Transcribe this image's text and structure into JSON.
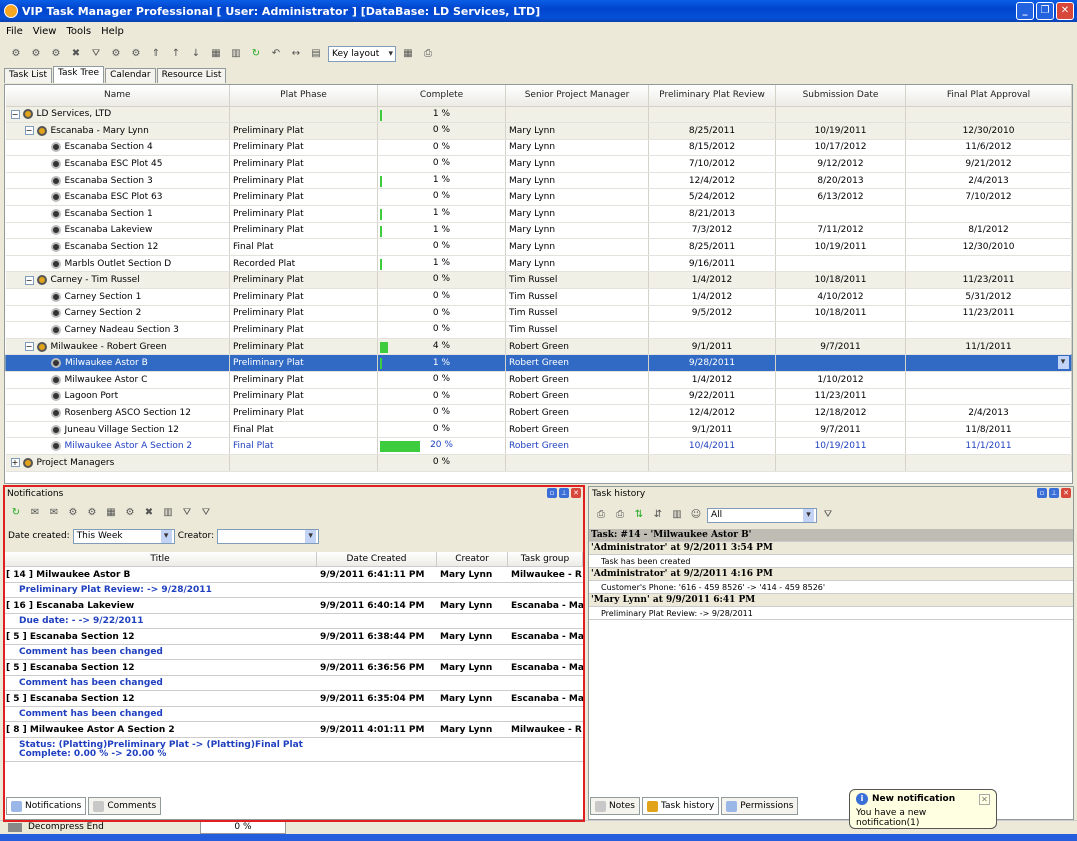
{
  "window": {
    "title": "VIP Task Manager Professional [ User: Administrator ] [DataBase: LD Services, LTD]"
  },
  "menu": [
    "File",
    "View",
    "Tools",
    "Help"
  ],
  "toolbar": {
    "layout_select": "Key layout"
  },
  "main_tabs": [
    "Task List",
    "Task Tree",
    "Calendar",
    "Resource List"
  ],
  "grid": {
    "columns": [
      "Name",
      "Plat Phase",
      "Complete",
      "Senior Project Manager",
      "Preliminary Plat Review",
      "Submission Date",
      "Final Plat Approval"
    ],
    "rows": [
      {
        "level": 0,
        "group": true,
        "name": "LD Services, LTD",
        "phase": "",
        "pct": 1,
        "complete": "1 %",
        "mgr": "",
        "review": "",
        "submit": "",
        "final": ""
      },
      {
        "level": 1,
        "group": true,
        "name": "Escanaba - Mary Lynn",
        "phase": "Preliminary Plat",
        "pct": 0,
        "complete": "0 %",
        "mgr": "Mary Lynn",
        "review": "8/25/2011",
        "submit": "10/19/2011",
        "final": "12/30/2010"
      },
      {
        "level": 2,
        "name": "Escanaba Section 4",
        "phase": "Preliminary Plat",
        "pct": 0,
        "complete": "0 %",
        "mgr": "Mary Lynn",
        "review": "8/15/2012",
        "submit": "10/17/2012",
        "final": "11/6/2012"
      },
      {
        "level": 2,
        "name": "Escanaba ESC Plot 45",
        "phase": "Preliminary Plat",
        "pct": 0,
        "complete": "0 %",
        "mgr": "Mary Lynn",
        "review": "7/10/2012",
        "submit": "9/12/2012",
        "final": "9/21/2012"
      },
      {
        "level": 2,
        "name": "Escanaba Section 3",
        "phase": "Preliminary Plat",
        "pct": 1,
        "complete": "1 %",
        "mgr": "Mary Lynn",
        "review": "12/4/2012",
        "submit": "8/20/2013",
        "final": "2/4/2013"
      },
      {
        "level": 2,
        "name": "Escanaba ESC Plot 63",
        "phase": "Preliminary Plat",
        "pct": 0,
        "complete": "0 %",
        "mgr": "Mary Lynn",
        "review": "5/24/2012",
        "submit": "6/13/2012",
        "final": "7/10/2012"
      },
      {
        "level": 2,
        "name": "Escanaba Section 1",
        "phase": "Preliminary Plat",
        "pct": 1,
        "complete": "1 %",
        "mgr": "Mary Lynn",
        "review": "8/21/2013",
        "submit": "",
        "final": ""
      },
      {
        "level": 2,
        "name": "Escanaba Lakeview",
        "phase": "Preliminary Plat",
        "pct": 1,
        "complete": "1 %",
        "mgr": "Mary Lynn",
        "review": "7/3/2012",
        "submit": "7/11/2012",
        "final": "8/1/2012"
      },
      {
        "level": 2,
        "name": "Escanaba Section 12",
        "phase": "Final Plat",
        "pct": 0,
        "complete": "0 %",
        "mgr": "Mary Lynn",
        "review": "8/25/2011",
        "submit": "10/19/2011",
        "final": "12/30/2010"
      },
      {
        "level": 2,
        "name": "Marbls Outlet Section D",
        "phase": "Recorded Plat",
        "pct": 1,
        "complete": "1 %",
        "mgr": "Mary Lynn",
        "review": "9/16/2011",
        "submit": "",
        "final": ""
      },
      {
        "level": 1,
        "group": true,
        "name": "Carney - Tim Russel",
        "phase": "Preliminary Plat",
        "pct": 0,
        "complete": "0 %",
        "mgr": "Tim Russel",
        "review": "1/4/2012",
        "submit": "10/18/2011",
        "final": "11/23/2011"
      },
      {
        "level": 2,
        "name": "Carney Section 1",
        "phase": "Preliminary Plat",
        "pct": 0,
        "complete": "0 %",
        "mgr": "Tim Russel",
        "review": "1/4/2012",
        "submit": "4/10/2012",
        "final": "5/31/2012"
      },
      {
        "level": 2,
        "name": "Carney Section 2",
        "phase": "Preliminary Plat",
        "pct": 0,
        "complete": "0 %",
        "mgr": "Tim Russel",
        "review": "9/5/2012",
        "submit": "10/18/2011",
        "final": "11/23/2011"
      },
      {
        "level": 2,
        "name": "Carney Nadeau Section 3",
        "phase": "Preliminary Plat",
        "pct": 0,
        "complete": "0 %",
        "mgr": "Tim Russel",
        "review": "",
        "submit": "",
        "final": ""
      },
      {
        "level": 1,
        "group": true,
        "name": "Milwaukee - Robert Green",
        "phase": "Preliminary Plat",
        "pct": 4,
        "complete": "4 %",
        "mgr": "Robert Green",
        "review": "9/1/2011",
        "submit": "9/7/2011",
        "final": "11/1/2011"
      },
      {
        "level": 2,
        "selected": true,
        "name": "Milwaukee Astor B",
        "phase": "Preliminary Plat",
        "pct": 1,
        "complete": "1 %",
        "mgr": "Robert Green",
        "review": "9/28/2011",
        "submit": "",
        "final": ""
      },
      {
        "level": 2,
        "name": "Milwaukee Astor C",
        "phase": "Preliminary Plat",
        "pct": 0,
        "complete": "0 %",
        "mgr": "Robert Green",
        "review": "1/4/2012",
        "submit": "1/10/2012",
        "final": ""
      },
      {
        "level": 2,
        "name": "Lagoon Port",
        "phase": "Preliminary Plat",
        "pct": 0,
        "complete": "0 %",
        "mgr": "Robert Green",
        "review": "9/22/2011",
        "submit": "11/23/2011",
        "final": ""
      },
      {
        "level": 2,
        "name": "Rosenberg ASCO Section 12",
        "phase": "Preliminary Plat",
        "pct": 0,
        "complete": "0 %",
        "mgr": "Robert Green",
        "review": "12/4/2012",
        "submit": "12/18/2012",
        "final": "2/4/2013"
      },
      {
        "level": 2,
        "name": "Juneau Village Section 12",
        "phase": "Final Plat",
        "pct": 0,
        "complete": "0 %",
        "mgr": "Robert Green",
        "review": "9/1/2011",
        "submit": "9/7/2011",
        "final": "11/8/2011"
      },
      {
        "level": 2,
        "blue": true,
        "name": "Milwaukee  Astor A Section 2",
        "phase": "Final Plat",
        "pct": 20,
        "complete": "20 %",
        "mgr": "Robert Green",
        "review": "10/4/2011",
        "submit": "10/19/2011",
        "final": "11/1/2011"
      },
      {
        "level": 0,
        "group": true,
        "collapsed": true,
        "name": "Project Managers",
        "phase": "",
        "pct": 0,
        "complete": "0 %",
        "mgr": "",
        "review": "",
        "submit": "",
        "final": ""
      }
    ]
  },
  "notifications": {
    "title": "Notifications",
    "date_label": "Date created:",
    "date_value": "This Week",
    "creator_label": "Creator:",
    "creator_value": "",
    "columns": [
      "Title",
      "Date Created",
      "Creator",
      "Task group"
    ],
    "items": [
      {
        "title": "[ 14 ] Milwaukee Astor B",
        "date": "9/9/2011 6:41:11 PM",
        "creator": "Mary Lynn",
        "group": "Milwaukee - R",
        "detail": "Preliminary Plat Review:  -> 9/28/2011"
      },
      {
        "title": "[ 16 ] Escanaba Lakeview",
        "date": "9/9/2011 6:40:14 PM",
        "creator": "Mary Lynn",
        "group": "Escanaba - Ma",
        "detail": "Due date:  - -> 9/22/2011"
      },
      {
        "title": "[ 5 ] Escanaba Section 12",
        "date": "9/9/2011 6:38:44 PM",
        "creator": "Mary Lynn",
        "group": "Escanaba - Ma",
        "detail": "Comment has been changed"
      },
      {
        "title": "[ 5 ] Escanaba Section 12",
        "date": "9/9/2011 6:36:56 PM",
        "creator": "Mary Lynn",
        "group": "Escanaba - Ma",
        "detail": "Comment has been changed"
      },
      {
        "title": "[ 5 ] Escanaba Section 12",
        "date": "9/9/2011 6:35:04 PM",
        "creator": "Mary Lynn",
        "group": "Escanaba - Ma",
        "detail": "Comment has been changed"
      },
      {
        "title": "[ 8 ] Milwaukee  Astor A Section 2",
        "date": "9/9/2011 4:01:11 PM",
        "creator": "Mary Lynn",
        "group": "Milwaukee - R",
        "detail": "Status: (Platting)Preliminary Plat -> (Platting)Final Plat",
        "detail2": "Complete: 0.00 % -> 20.00 %"
      }
    ],
    "tabs": [
      "Notifications",
      "Comments"
    ]
  },
  "history": {
    "title": "Task history",
    "filter": "All",
    "task_caption": "Task: #14 - 'Milwaukee Astor B'",
    "entries": [
      {
        "header": "'Administrator' at 9/2/2011 3:54 PM",
        "text": "Task has been created"
      },
      {
        "header": "'Administrator' at 9/2/2011 4:16 PM",
        "text": "Customer's Phone: '616 - 459 8526' -> '414 - 459 8526'"
      },
      {
        "header": "'Mary Lynn' at 9/9/2011 6:41 PM",
        "text": "Preliminary Plat Review:  -> 9/28/2011"
      }
    ],
    "tabs": [
      "Notes",
      "Task history",
      "Permissions"
    ]
  },
  "balloon": {
    "title": "New notification",
    "text": "You have a new notification(1)"
  },
  "status": {
    "text": "Decompress End",
    "progress": "0 %"
  },
  "colors": {
    "selection": "#316AC5",
    "progress": "#3DCC3D",
    "link": "#1F3FBF",
    "highlight_border": "#E02020"
  }
}
